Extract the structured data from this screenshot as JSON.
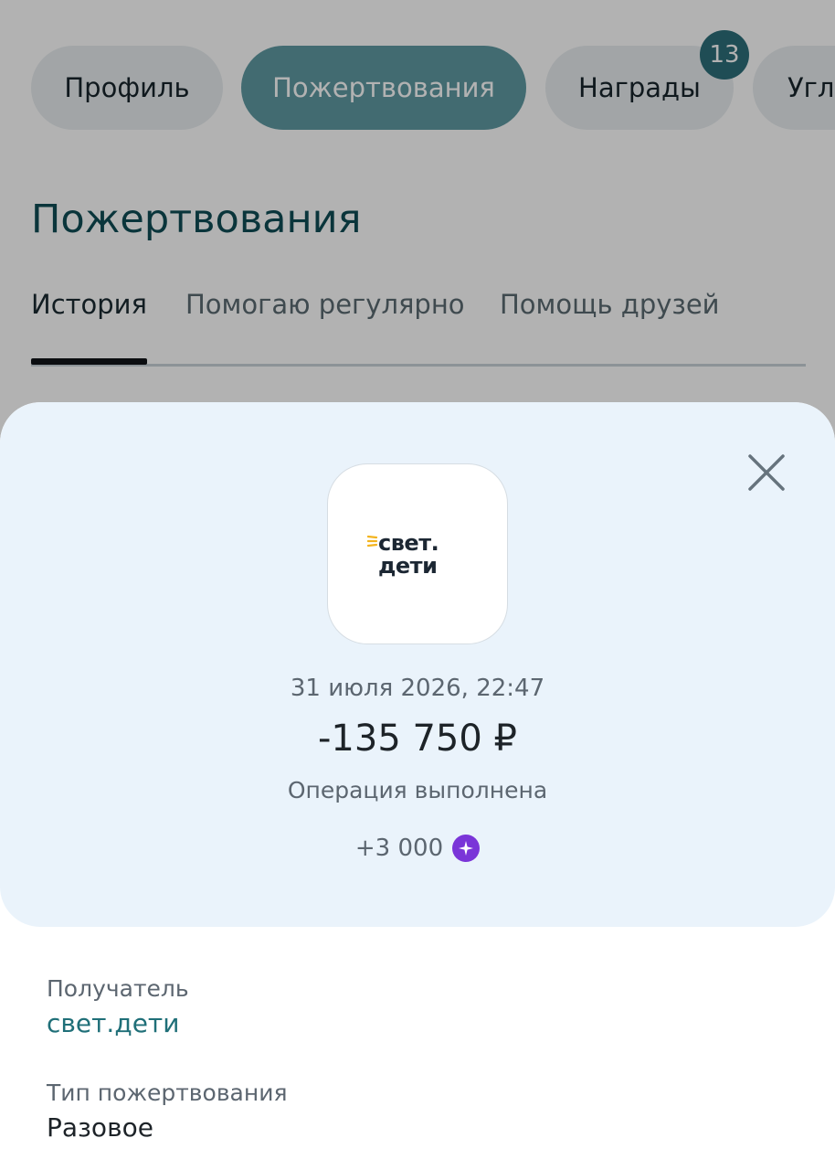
{
  "top_tabs": [
    {
      "label": "Профиль"
    },
    {
      "label": "Пожертвования"
    },
    {
      "label": "Награды"
    },
    {
      "label": "Угл"
    }
  ],
  "awards_badge": "13",
  "page_title": "Пожертвования",
  "sub_tabs": [
    {
      "label": "История"
    },
    {
      "label": "Помогаю регулярно"
    },
    {
      "label": "Помощь друзей"
    }
  ],
  "sheet": {
    "logo": {
      "line1": "свет.",
      "line2": "дети"
    },
    "date": "31 июля 2026, 22:47",
    "amount": "-135 750 ₽",
    "status": "Операция выполнена",
    "bonus": "+3 000",
    "details": [
      {
        "label": "Получатель",
        "value": "свет.дети"
      },
      {
        "label": "Тип пожертвования",
        "value": "Разовое"
      }
    ]
  },
  "colors": {
    "accent_teal": "#2d6f7a",
    "link_teal": "#1f6f78",
    "bonus_purple": "#7a35d8",
    "sheet_hero_bg": "#eaf3fb"
  },
  "icons": [
    "close-icon",
    "sparkle-icon"
  ]
}
